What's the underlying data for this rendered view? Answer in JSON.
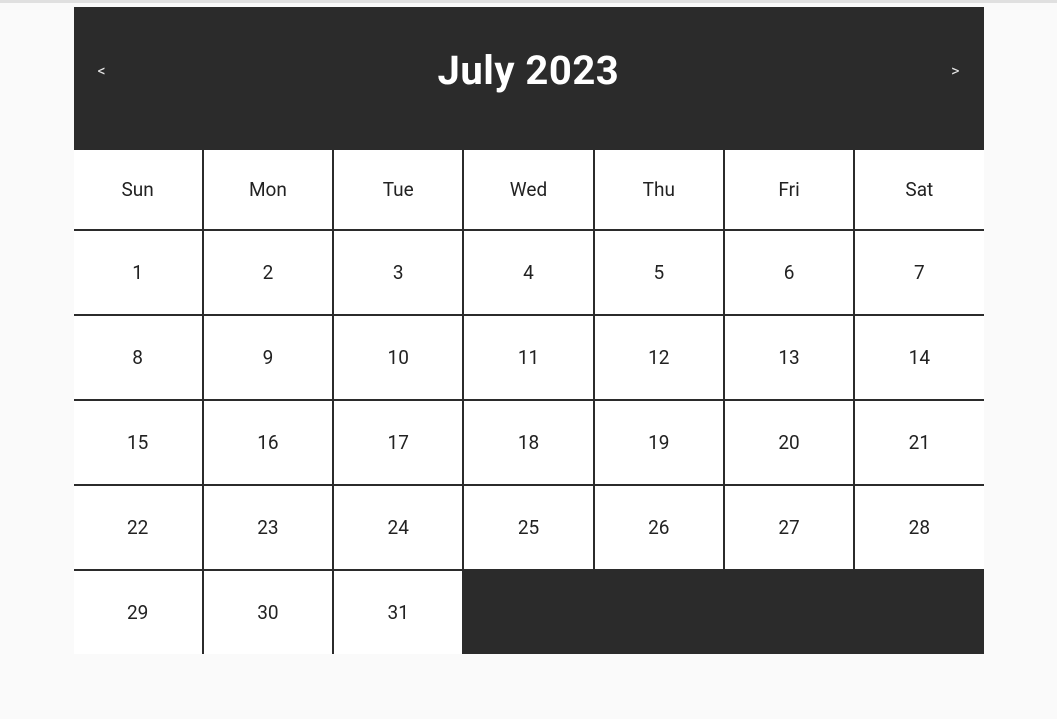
{
  "calendar": {
    "title": "July 2023",
    "prev": "<",
    "next": ">",
    "daysOfWeek": [
      "Sun",
      "Mon",
      "Tue",
      "Wed",
      "Thu",
      "Fri",
      "Sat"
    ],
    "cells": [
      {
        "day": "1"
      },
      {
        "day": "2"
      },
      {
        "day": "3"
      },
      {
        "day": "4"
      },
      {
        "day": "5"
      },
      {
        "day": "6"
      },
      {
        "day": "7"
      },
      {
        "day": "8"
      },
      {
        "day": "9"
      },
      {
        "day": "10"
      },
      {
        "day": "11"
      },
      {
        "day": "12"
      },
      {
        "day": "13"
      },
      {
        "day": "14"
      },
      {
        "day": "15"
      },
      {
        "day": "16"
      },
      {
        "day": "17"
      },
      {
        "day": "18"
      },
      {
        "day": "19"
      },
      {
        "day": "20"
      },
      {
        "day": "21"
      },
      {
        "day": "22"
      },
      {
        "day": "23"
      },
      {
        "day": "24"
      },
      {
        "day": "25"
      },
      {
        "day": "26"
      },
      {
        "day": "27"
      },
      {
        "day": "28"
      },
      {
        "day": "29"
      },
      {
        "day": "30"
      },
      {
        "day": "31"
      },
      {
        "empty": true
      },
      {
        "empty": true
      },
      {
        "empty": true
      },
      {
        "empty": true
      }
    ]
  }
}
